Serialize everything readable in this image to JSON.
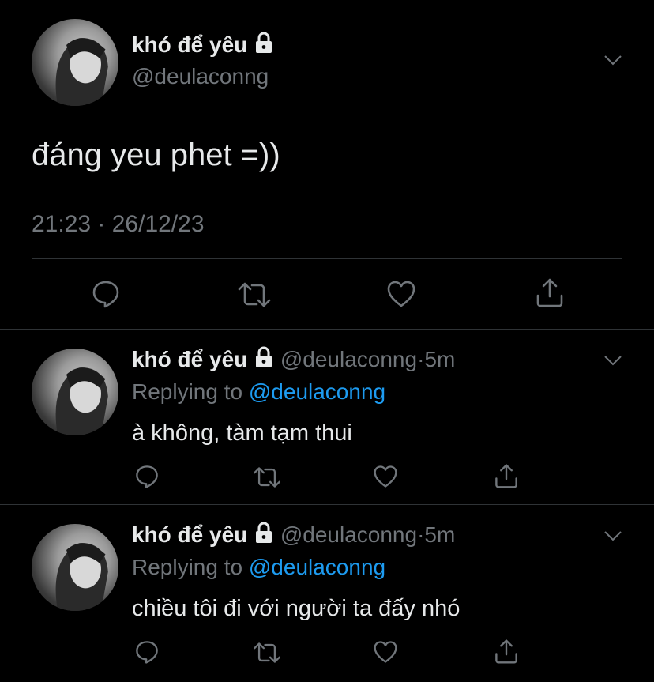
{
  "main_tweet": {
    "display_name": "khó để yêu",
    "handle": "@deulaconng",
    "text": "đáng yeu phet =))",
    "timestamp": "21:23 · 26/12/23"
  },
  "replies": [
    {
      "display_name": "khó để yêu",
      "handle": "@deulaconng",
      "separator": "·",
      "time": "5m",
      "replying_prefix": "Replying to",
      "replying_handle": "@deulaconng",
      "text": "à không, tàm tạm thui"
    },
    {
      "display_name": "khó để yêu",
      "handle": "@deulaconng",
      "separator": "·",
      "time": "5m",
      "replying_prefix": "Replying to",
      "replying_handle": "@deulaconng",
      "text": "chiều tôi đi với người ta đấy nhó"
    }
  ],
  "icons": [
    "lock-icon",
    "chevron-down-icon",
    "reply-icon",
    "retweet-icon",
    "like-icon",
    "share-icon"
  ],
  "colors": {
    "background": "#000000",
    "text": "#e7e9ea",
    "muted": "#71767b",
    "link": "#1d9bf0",
    "divider": "#2f3336"
  }
}
